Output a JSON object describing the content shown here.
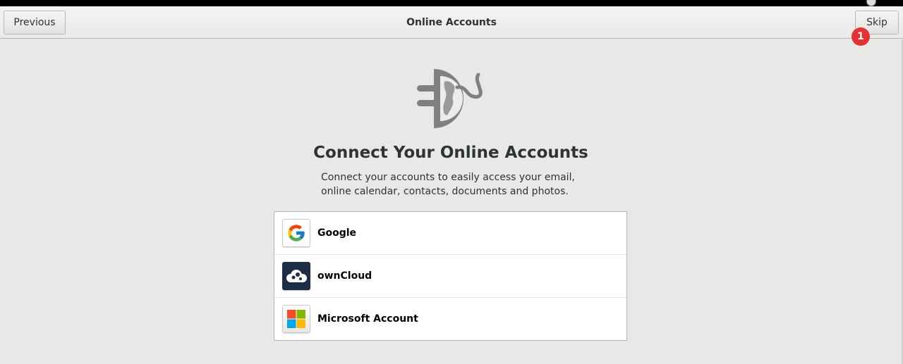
{
  "window": {
    "title": "Online Accounts"
  },
  "header": {
    "previous_label": "Previous",
    "skip_label": "Skip",
    "badge_count": "1"
  },
  "main": {
    "heading": "Connect Your Online Accounts",
    "description_lines": [
      "Connect your accounts to easily access your email,",
      "online calendar, contacts, documents and photos."
    ],
    "hero_icon": "online-accounts-plug-icon"
  },
  "providers": [
    {
      "label": "Google",
      "icon": "google-icon"
    },
    {
      "label": "ownCloud",
      "icon": "owncloud-icon"
    },
    {
      "label": "Microsoft Account",
      "icon": "microsoft-icon"
    }
  ],
  "colors": {
    "background": "#e8e8e7",
    "badge": "#e5312f",
    "owncloud_tile": "#1d2d44"
  }
}
